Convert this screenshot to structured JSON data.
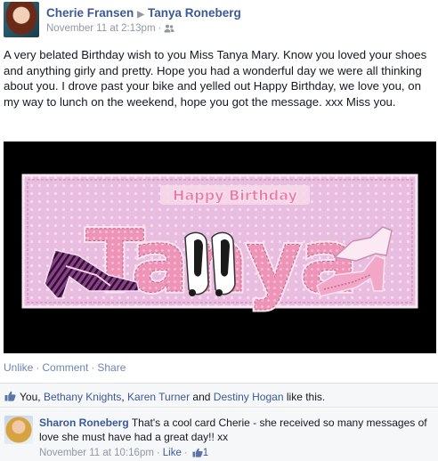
{
  "post": {
    "author": "Cherie Fransen",
    "recipient": "Tanya Roneberg",
    "timestamp": "November 11 at 2:13pm",
    "audience_icon": "friends-icon",
    "message": "A very belated Birthday wish to you Miss Tanya Mary. Know you loved your shoes and anything girly and pretty. Hope you had a wonderful day we were all thinking about you. I drove past your bike and yelled out Happy Birthday, we love you, on my way to lunch on the weekend, hope you got the message. xxx Miss you."
  },
  "photo": {
    "card_heading": "Happy Birthday",
    "card_name": "Tanya",
    "colors": {
      "card_bg": "#e7b9dd",
      "letters": "#ec8fb3",
      "letters_dark": "#c5658c"
    }
  },
  "actions": {
    "unlike": "Unlike",
    "comment": "Comment",
    "share": "Share",
    "separator": "·"
  },
  "likes": {
    "prefix": "You,",
    "people": [
      "Bethany Knights",
      "Karen Turner",
      "Destiny Hogan"
    ],
    "sep1": ",",
    "and": "and",
    "suffix": "like this."
  },
  "comment": {
    "author": "Sharon Roneberg",
    "text": "That's a cool card Cherie - she received so many messages of love she must have had a great day!! xx",
    "timestamp": "November 11 at 10:16pm",
    "like_label": "Like",
    "like_count": "1",
    "separator": "·"
  },
  "colors": {
    "link": "#3b5998",
    "action_link": "#6d84b4",
    "meta": "#9197a3",
    "panel_bg": "#f6f7f9"
  }
}
